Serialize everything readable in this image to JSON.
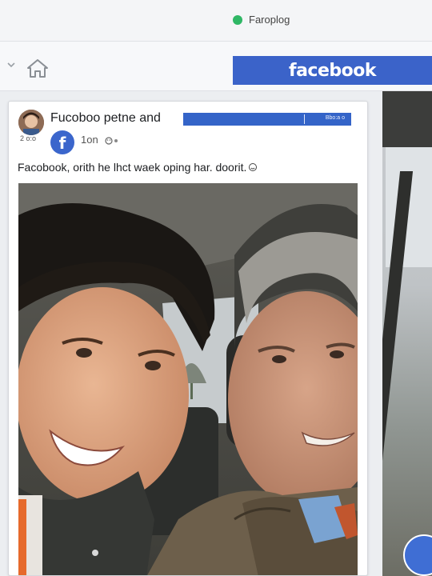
{
  "status": {
    "text": "Faroplog",
    "dot_color": "#2fb765"
  },
  "toolbar": {
    "brand_label": "facebook",
    "brand_color": "#3b63c9",
    "back_icon": "chevron-down-icon",
    "home_icon": "home-icon"
  },
  "post": {
    "author": "Fucoboo petne and",
    "avatar_caption": "2 o:o",
    "blue_bar_label": "Bbo:a o",
    "badge_glyph": "f",
    "meta": "1on",
    "meta_icon": "emoji-icon",
    "text": "Facobook, orith he lhct waek oping har. doorit.",
    "photo_description_icon": "selfie-photo"
  }
}
